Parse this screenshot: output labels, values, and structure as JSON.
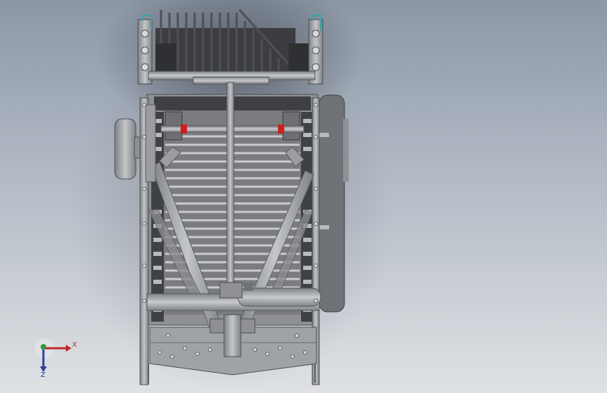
{
  "viewport": {
    "background_top": "#8c97a5",
    "background_bottom": "#dfe1e4",
    "steel_color": "#9b9da0",
    "steel_dark": "#5e6064",
    "accent_red": "#cc1f1f",
    "accent_teal": "#3aa3a7"
  },
  "triad": {
    "x_label": "X",
    "z_label": "Z",
    "x_color": "#c0282a",
    "y_color": "#2f9a3a",
    "z_color": "#2a3f9e"
  }
}
